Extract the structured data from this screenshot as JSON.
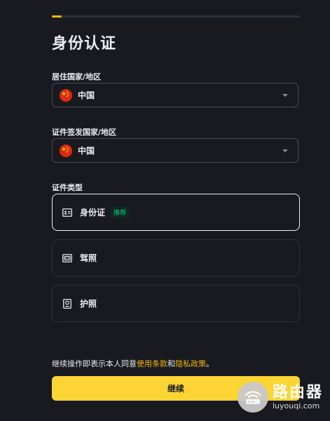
{
  "progress": {
    "value": 0.04
  },
  "page_title": "身份认证",
  "residence": {
    "label": "居住国家/地区",
    "value": "中国"
  },
  "issuer": {
    "label": "证件签发国家/地区",
    "value": "中国"
  },
  "doc_type": {
    "label": "证件类型",
    "options": [
      {
        "label": "身份证",
        "badge": "推荐",
        "icon": "id-card-icon",
        "selected": true
      },
      {
        "label": "驾照",
        "icon": "drivers-license-icon",
        "selected": false
      },
      {
        "label": "护照",
        "icon": "passport-icon",
        "selected": false
      }
    ]
  },
  "consent": {
    "prefix": "继续操作即表示本人同意",
    "terms": "使用条款",
    "and": "和",
    "privacy": "隐私政策",
    "suffix": "。"
  },
  "continue_label": "继续",
  "watermark": {
    "title": "路由器",
    "subtitle": "luyouqi.com"
  },
  "colors": {
    "accent": "#fcd535",
    "link": "#f0b90b",
    "background": "#181a20",
    "badge": "#0ecb81"
  }
}
